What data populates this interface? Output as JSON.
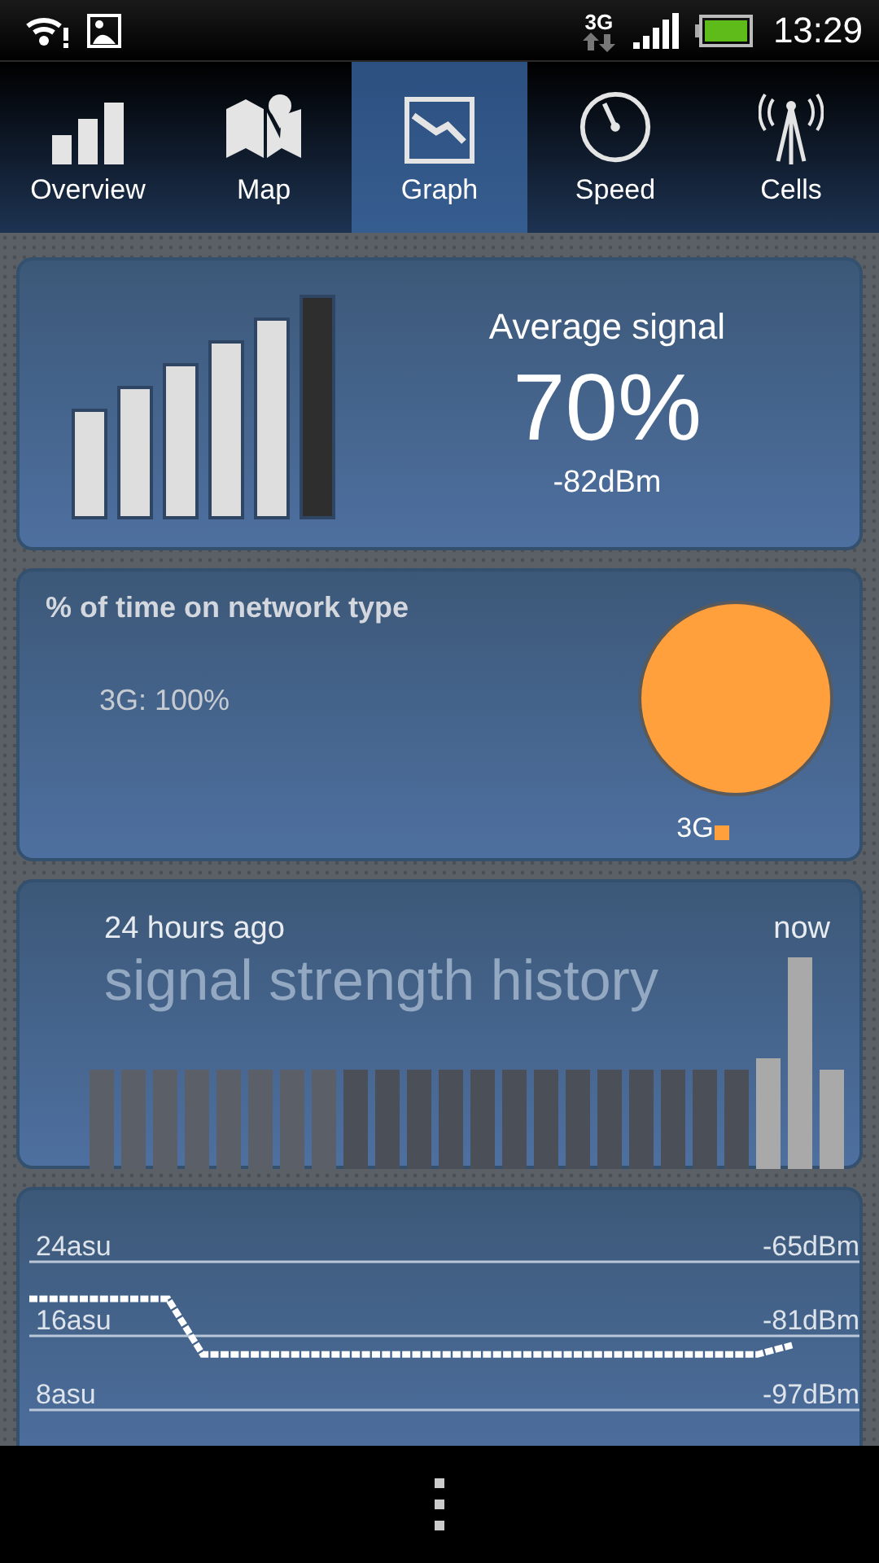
{
  "status_bar": {
    "network": "3G",
    "time": "13:29"
  },
  "tabs": [
    {
      "label": "Overview",
      "selected": false
    },
    {
      "label": "Map",
      "selected": false
    },
    {
      "label": "Graph",
      "selected": true
    },
    {
      "label": "Speed",
      "selected": false
    },
    {
      "label": "Cells",
      "selected": false
    }
  ],
  "average_signal": {
    "title": "Average signal",
    "percent": "70%",
    "dbm": "-82dBm"
  },
  "network_type": {
    "title": "% of time on network type",
    "summary": "3G: 100%",
    "chart_data": {
      "type": "pie",
      "categories": [
        "3G"
      ],
      "series": [
        {
          "color": "#ffa03c",
          "values": [
            100
          ]
        }
      ]
    }
  },
  "history": {
    "start_label": "24 hours ago",
    "end_label": "now",
    "title": "signal strength history"
  },
  "signal_graph": {
    "dbm_labels": [
      "-65dBm",
      "-81dBm",
      "-97dBm"
    ],
    "chart_data": {
      "type": "line",
      "ylim": [
        8,
        24
      ],
      "yticks": [
        {
          "value": 24,
          "label": "24asu"
        },
        {
          "value": 16,
          "label": "16asu"
        },
        {
          "value": 8,
          "label": "8asu"
        }
      ],
      "series": [
        {
          "color": "#ffffff",
          "line_style": "dashed",
          "values": [
            20,
            20,
            20,
            20,
            20,
            14,
            14,
            14,
            14,
            14,
            14,
            14,
            14,
            14,
            14,
            14,
            14,
            14,
            14,
            14,
            14,
            14,
            15,
            null,
            null
          ]
        }
      ]
    }
  }
}
